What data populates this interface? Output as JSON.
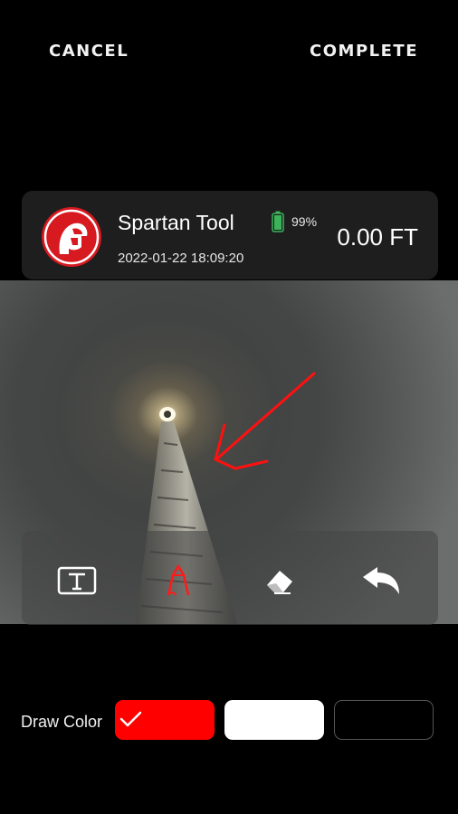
{
  "topbar": {
    "cancel_label": "CANCEL",
    "complete_label": "COMPLETE"
  },
  "info_card": {
    "title": "Spartan Tool",
    "battery_percent": "99%",
    "battery_level": 0.99,
    "datetime": "2022-01-22 18:09:20",
    "distance": "0.00 FT"
  },
  "toolbar": {
    "tools": [
      "text-tool-icon",
      "pen-tool-icon",
      "eraser-icon",
      "undo-icon"
    ],
    "active_tool": "pen-tool-icon"
  },
  "draw_color": {
    "label": "Draw Color",
    "options": [
      "#ff0000",
      "#ffffff",
      "#000000"
    ],
    "selected": "#ff0000"
  },
  "colors": {
    "accent": "#ff0000",
    "card_bg": "#1e1e1e",
    "logo_red": "#d71920"
  }
}
